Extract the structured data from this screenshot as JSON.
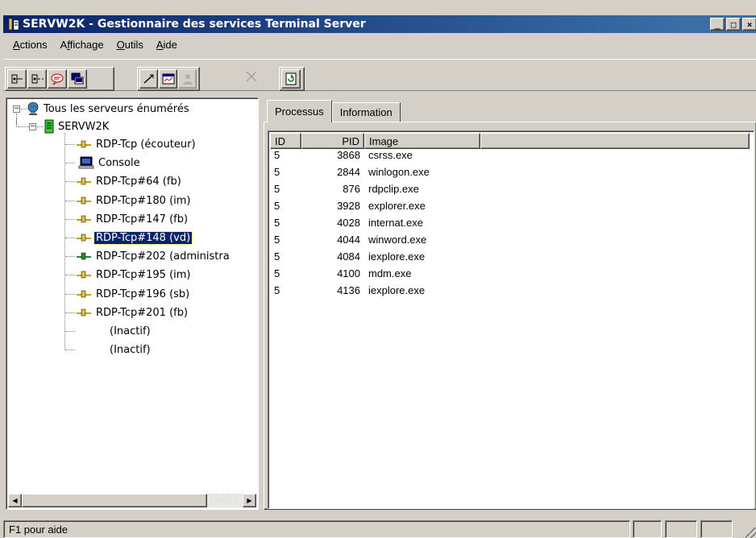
{
  "window": {
    "title": "SERVW2K - Gestionnaire des services Terminal Server",
    "buttons": [
      "_",
      "□",
      "×"
    ]
  },
  "menubar": {
    "items": [
      {
        "label": "Actions",
        "accel": "A"
      },
      {
        "label": "Affichage",
        "accel": "f"
      },
      {
        "label": "Outils",
        "accel": "O"
      },
      {
        "label": "Aide",
        "accel": "A"
      }
    ]
  },
  "toolbar": {
    "icons": [
      "connect-icon",
      "disconnect-icon",
      "send-message-icon",
      "remote-control-icon",
      "reset-icon",
      "status-icon",
      "logoff-icon",
      "end-process-icon",
      "refresh-icon"
    ]
  },
  "tree": {
    "root": "Tous les serveurs énumérés",
    "server": "SERVW2K",
    "sessions": [
      {
        "label": "RDP-Tcp (écouteur)",
        "icon": "network-session-icon"
      },
      {
        "label": "Console",
        "icon": "console-icon"
      },
      {
        "label": "RDP-Tcp#64 (fb)",
        "icon": "network-session-icon"
      },
      {
        "label": "RDP-Tcp#180 (im)",
        "icon": "network-session-icon"
      },
      {
        "label": "RDP-Tcp#147 (fb)",
        "icon": "network-session-icon"
      },
      {
        "label": "RDP-Tcp#148 (vd)",
        "icon": "network-session-icon",
        "selected": true
      },
      {
        "label": "RDP-Tcp#202 (administra",
        "icon": "network-session-active-icon"
      },
      {
        "label": "RDP-Tcp#195 (im)",
        "icon": "network-session-icon"
      },
      {
        "label": "RDP-Tcp#196 (sb)",
        "icon": "network-session-icon"
      },
      {
        "label": "RDP-Tcp#201 (fb)",
        "icon": "network-session-icon"
      },
      {
        "label": "(Inactif)",
        "icon": ""
      },
      {
        "label": "(Inactif)",
        "icon": ""
      }
    ]
  },
  "tabs": [
    {
      "label": "Processus",
      "active": true
    },
    {
      "label": "Information",
      "active": false
    }
  ],
  "processes": {
    "columns": [
      "ID",
      "PID",
      "Image"
    ],
    "rows": [
      [
        "5",
        "3868",
        "csrss.exe"
      ],
      [
        "5",
        "2844",
        "winlogon.exe"
      ],
      [
        "5",
        "876",
        "rdpclip.exe"
      ],
      [
        "5",
        "3928",
        "explorer.exe"
      ],
      [
        "5",
        "4028",
        "internat.exe"
      ],
      [
        "5",
        "4044",
        "winword.exe"
      ],
      [
        "5",
        "4084",
        "iexplore.exe"
      ],
      [
        "5",
        "4100",
        "mdm.exe"
      ],
      [
        "5",
        "4136",
        "iexplore.exe"
      ]
    ]
  },
  "statusbar": {
    "text": "F1 pour aide"
  },
  "colors": {
    "titlebar_start": "#0a246a",
    "titlebar_end": "#3a6ea5",
    "face": "#d4d0c8",
    "selection": "#0a246a"
  }
}
